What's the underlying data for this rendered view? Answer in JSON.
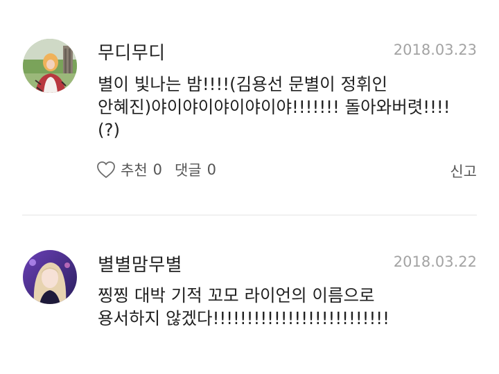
{
  "comments": [
    {
      "author": "무디무디",
      "date": "2018.03.23",
      "text_lines": [
        "별이 빛나는 밤!!!!(김용선 문별이 정휘인",
        "안혜진)야이야이야이야이야!!!!!!! 돌아와버렷!!!!",
        "(?)"
      ],
      "like_label": "추천",
      "like_count": "0",
      "reply_label": "댓글",
      "reply_count": "0",
      "report_label": "신고",
      "avatar_icon": "user-photo-avatar"
    },
    {
      "author": "별별맘무별",
      "date": "2018.03.22",
      "text_lines": [
        "찡찡 대박 기적 꼬모 라이언의 이름으로",
        "용서하지 않겠다!!!!!!!!!!!!!!!!!!!!!!!!!!"
      ],
      "avatar_icon": "user-photo-avatar"
    }
  ],
  "colors": {
    "date": "#a3a3a3",
    "divider": "#e4e4e4",
    "text": "#1f1f1f"
  },
  "icons": {
    "like": "heart-outline-icon"
  }
}
